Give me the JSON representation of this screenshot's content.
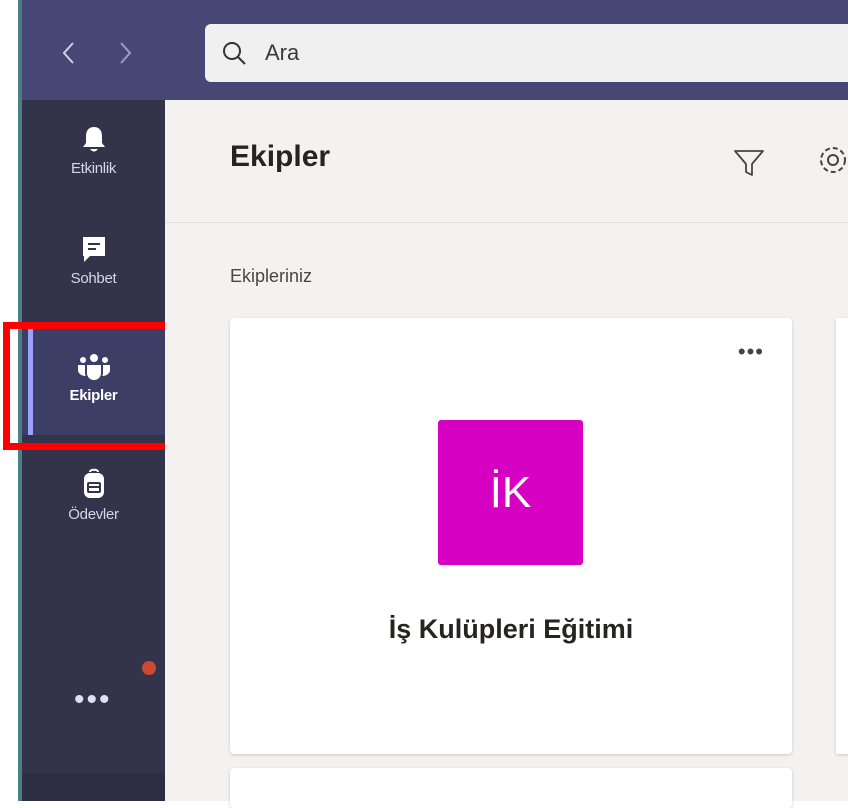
{
  "search": {
    "placeholder": "Ara"
  },
  "rail": {
    "items": [
      {
        "label": "Etkinlik",
        "icon": "bell-icon"
      },
      {
        "label": "Sohbet",
        "icon": "chat-icon"
      },
      {
        "label": "Ekipler",
        "icon": "teams-icon",
        "active": true
      },
      {
        "label": "Ödevler",
        "icon": "backpack-icon"
      }
    ],
    "more": "•••"
  },
  "header": {
    "title": "Ekipler"
  },
  "teams": {
    "section_label": "Ekipleriniz",
    "cards": [
      {
        "initials": "İK",
        "name": "İş Kulüpleri Eğitimi",
        "more": "•••",
        "color": "#d600c3"
      }
    ]
  },
  "colors": {
    "topbar": "#464775",
    "rail": "#33344a",
    "accent": "#9ea2ff",
    "highlight": "#ff0000",
    "notification": "#cc4a31"
  }
}
